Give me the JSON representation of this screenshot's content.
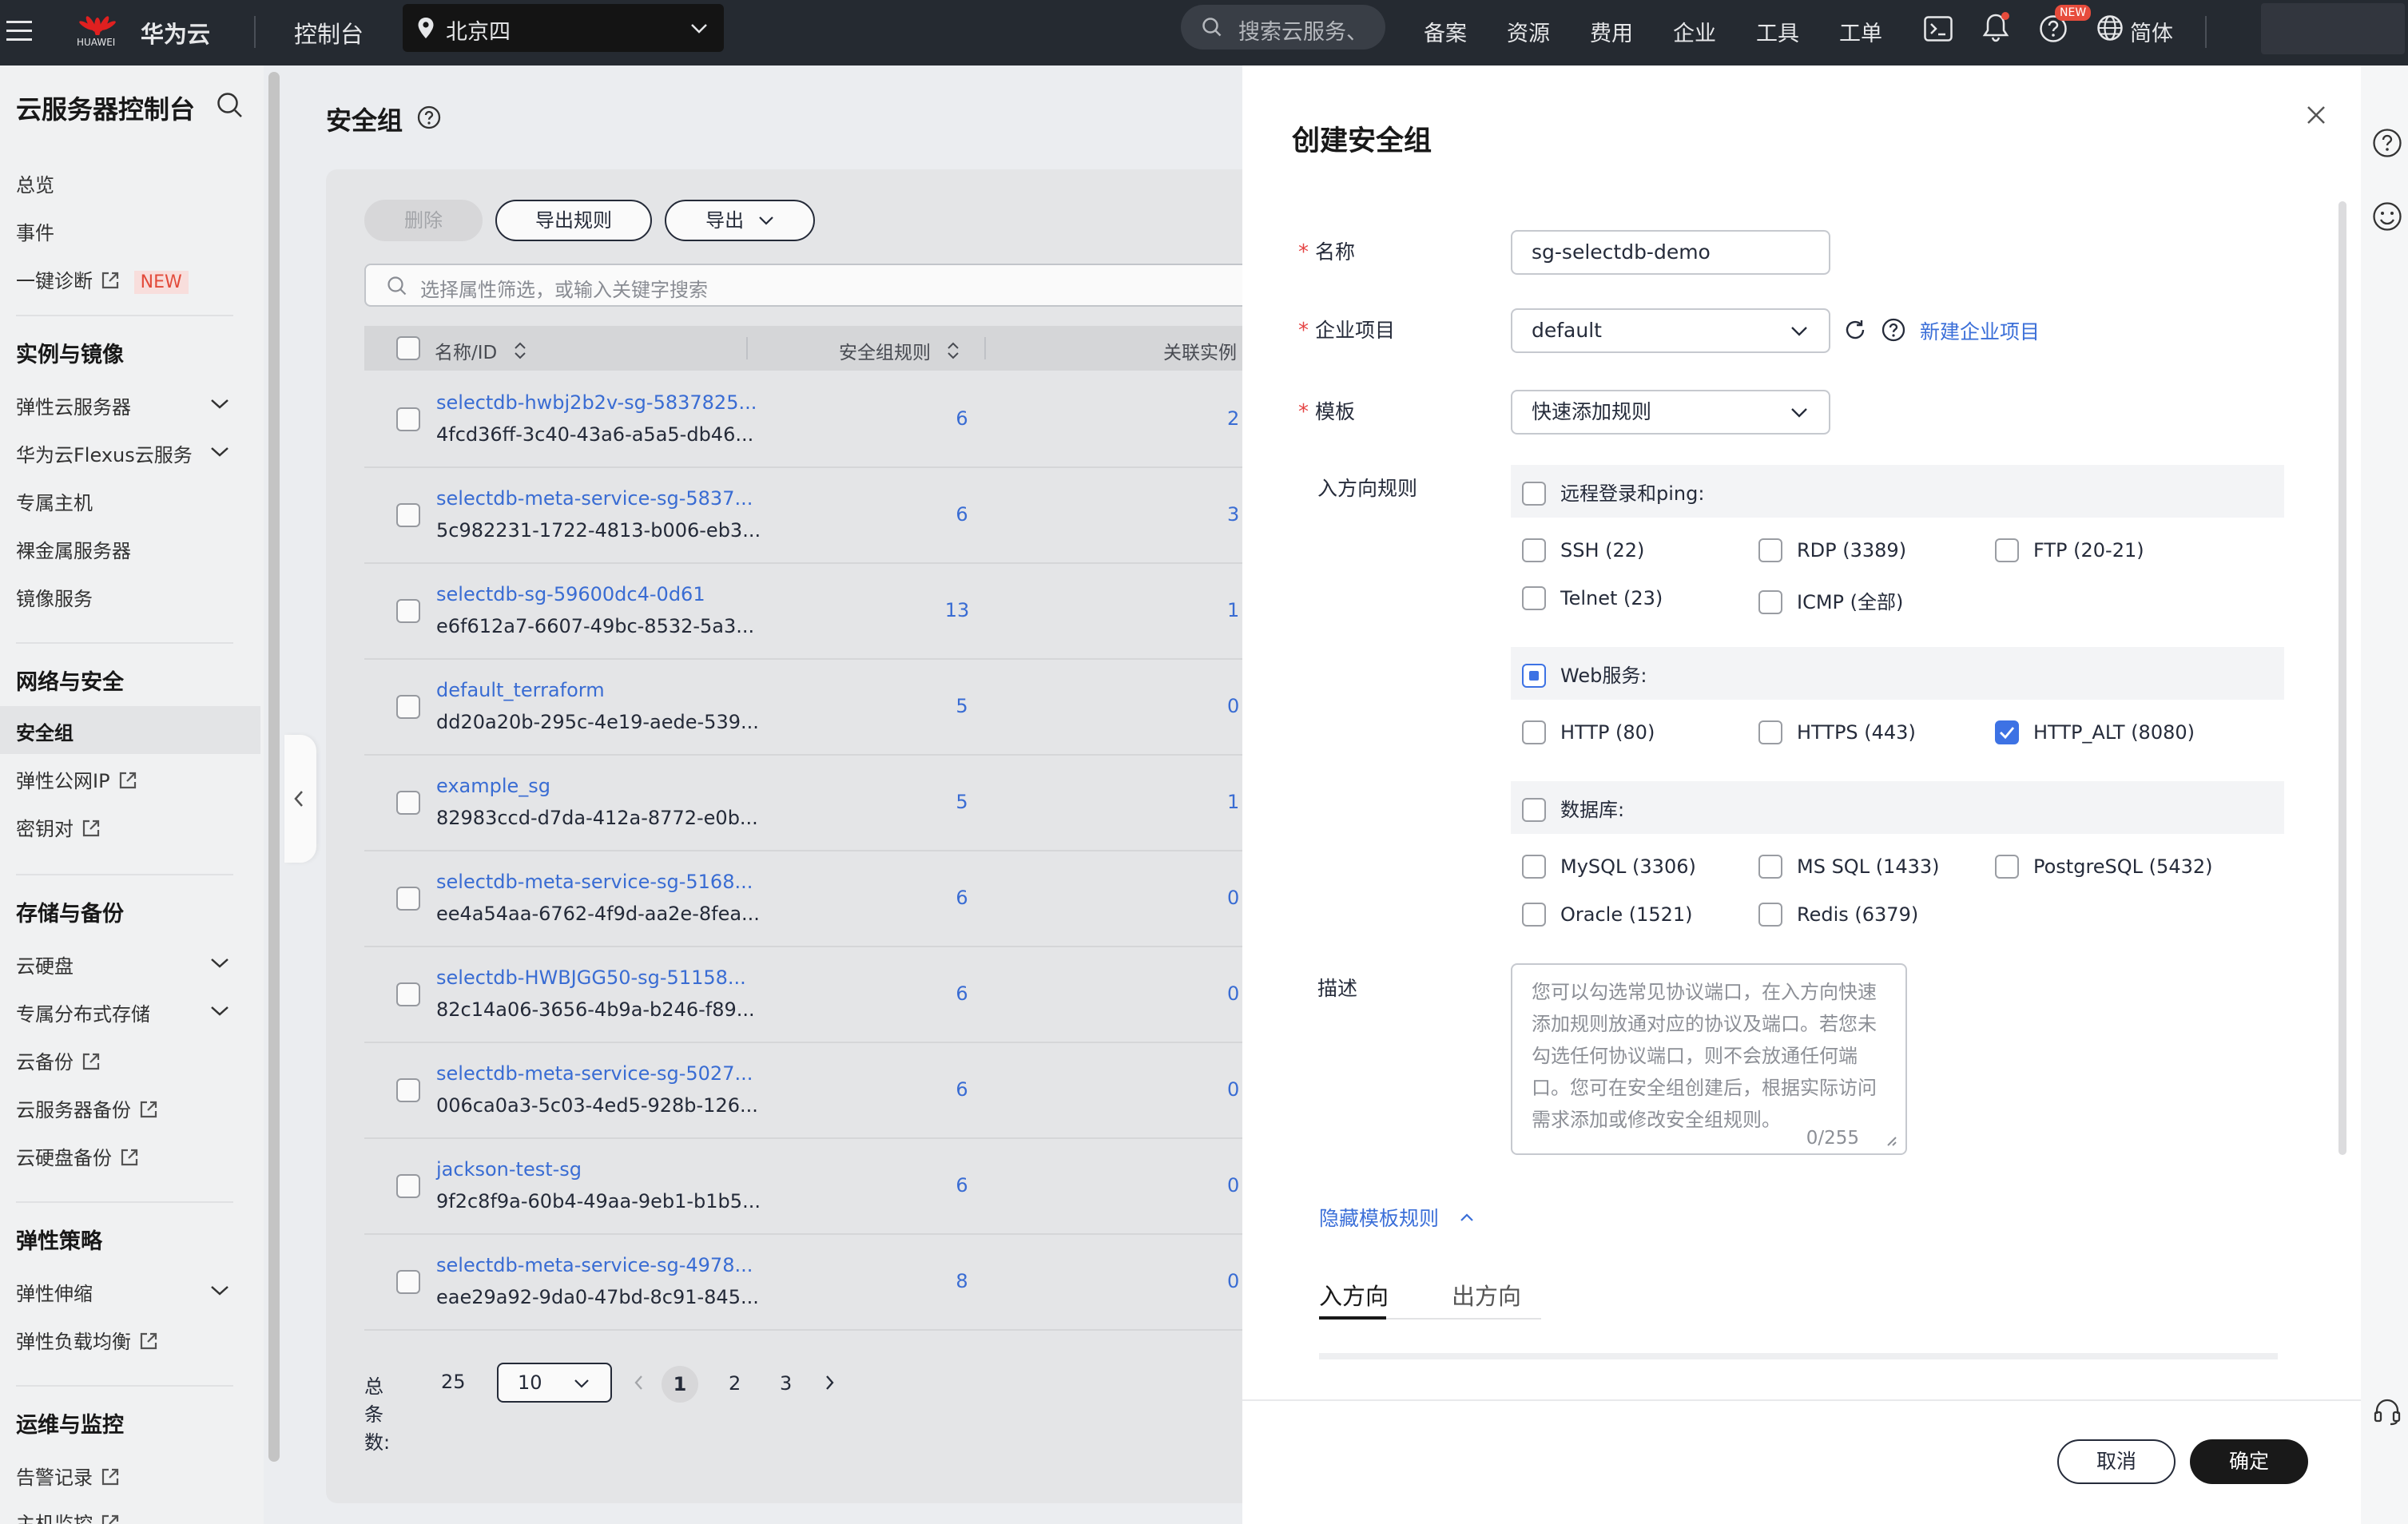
{
  "topbar": {
    "brand_small": "HUAWEI",
    "brand": "华为云",
    "console": "控制台",
    "region": "北京四",
    "search_placeholder": "搜索云服务、",
    "nav": [
      "备案",
      "资源",
      "费用",
      "企业",
      "工具",
      "工单"
    ],
    "new_badge": "NEW",
    "lang": "简体"
  },
  "sidebar": {
    "title": "云服务器控制台",
    "top_items": [
      {
        "label": "总览"
      },
      {
        "label": "事件"
      },
      {
        "label": "一键诊断",
        "badge": "NEW"
      }
    ],
    "groups": [
      {
        "title": "实例与镜像",
        "items": [
          "弹性云服务器",
          "华为云Flexus云服务",
          "专属主机",
          "裸金属服务器",
          "镜像服务"
        ]
      },
      {
        "title": "网络与安全",
        "items": [
          "安全组",
          "弹性公网IP",
          "密钥对"
        ]
      },
      {
        "title": "存储与备份",
        "items": [
          "云硬盘",
          "专属分布式存储",
          "云备份",
          "云服务器备份",
          "云硬盘备份"
        ]
      },
      {
        "title": "弹性策略",
        "items": [
          "弹性伸缩",
          "弹性负载均衡"
        ]
      },
      {
        "title": "运维与监控",
        "items": [
          "告警记录",
          "主机监控"
        ]
      }
    ],
    "active_item": "安全组"
  },
  "main": {
    "title": "安全组",
    "toolbar": {
      "delete": "删除",
      "export_rules": "导出规则",
      "export": "导出"
    },
    "filter_placeholder": "选择属性筛选，或输入关键字搜索",
    "columns": {
      "name": "名称/ID",
      "rules": "安全组规则",
      "related": "关联实例"
    },
    "rows": [
      {
        "name": "selectdb-hwbj2b2v-sg-5837825...",
        "id": "4fcd36ff-3c40-43a6-a5a5-db46...",
        "rules": "6",
        "related": "2"
      },
      {
        "name": "selectdb-meta-service-sg-5837...",
        "id": "5c982231-1722-4813-b006-eb3...",
        "rules": "6",
        "related": "3"
      },
      {
        "name": "selectdb-sg-59600dc4-0d61",
        "id": "e6f612a7-6607-49bc-8532-5a3...",
        "rules": "13",
        "related": "1"
      },
      {
        "name": "default_terraform",
        "id": "dd20a20b-295c-4e19-aede-539...",
        "rules": "5",
        "related": "0"
      },
      {
        "name": "example_sg",
        "id": "82983ccd-d7da-412a-8772-e0b...",
        "rules": "5",
        "related": "1"
      },
      {
        "name": "selectdb-meta-service-sg-5168...",
        "id": "ee4a54aa-6762-4f9d-aa2e-8fea...",
        "rules": "6",
        "related": "0"
      },
      {
        "name": "selectdb-HWBJGG50-sg-51158...",
        "id": "82c14a06-3656-4b9a-b246-f89...",
        "rules": "6",
        "related": "0"
      },
      {
        "name": "selectdb-meta-service-sg-5027...",
        "id": "006ca0a3-5c03-4ed5-928b-126...",
        "rules": "6",
        "related": "0"
      },
      {
        "name": "jackson-test-sg",
        "id": "9f2c8f9a-60b4-49aa-9eb1-b1b5...",
        "rules": "6",
        "related": "0"
      },
      {
        "name": "selectdb-meta-service-sg-4978...",
        "id": "eae29a92-9da0-47bd-8c91-845...",
        "rules": "8",
        "related": "0"
      }
    ],
    "pagination": {
      "total_label": "总条数:",
      "total": "25",
      "page_size": "10",
      "pages": [
        "1",
        "2",
        "3"
      ],
      "current": "1"
    }
  },
  "modal": {
    "title": "创建安全组",
    "name_label": "名称",
    "name_value": "sg-selectdb-demo",
    "project_label": "企业项目",
    "project_value": "default",
    "new_project_link": "新建企业项目",
    "template_label": "模板",
    "template_value": "快速添加规则",
    "inbound_label": "入方向规则",
    "sections": [
      {
        "title": "远程登录和ping:",
        "state": "unchecked",
        "options": [
          {
            "label": "SSH (22)",
            "checked": false
          },
          {
            "label": "RDP (3389)",
            "checked": false
          },
          {
            "label": "FTP (20-21)",
            "checked": false
          },
          {
            "label": "Telnet (23)",
            "checked": false
          },
          {
            "label": "ICMP (全部)",
            "checked": false
          }
        ]
      },
      {
        "title": "Web服务:",
        "state": "partial",
        "options": [
          {
            "label": "HTTP (80)",
            "checked": false
          },
          {
            "label": "HTTPS (443)",
            "checked": false
          },
          {
            "label": "HTTP_ALT (8080)",
            "checked": true
          }
        ]
      },
      {
        "title": "数据库:",
        "state": "unchecked",
        "options": [
          {
            "label": "MySQL (3306)",
            "checked": false
          },
          {
            "label": "MS SQL (1433)",
            "checked": false
          },
          {
            "label": "PostgreSQL (5432)",
            "checked": false
          },
          {
            "label": "Oracle (1521)",
            "checked": false
          },
          {
            "label": "Redis (6379)",
            "checked": false
          }
        ]
      }
    ],
    "desc_label": "描述",
    "desc_placeholder": "您可以勾选常见协议端口，在入方向快速添加规则放通对应的协议及端口。若您未勾选任何协议端口，则不会放通任何端口。您可在安全组创建后，根据实际访问需求添加或修改安全组规则。",
    "desc_count": "0/255",
    "hide_template_link": "隐藏模板规则",
    "tabs": {
      "inbound": "入方向",
      "outbound": "出方向"
    },
    "cancel": "取消",
    "confirm": "确定"
  },
  "colors": {
    "link": "#3b6fd8",
    "topbar": "#252a31",
    "checkbox_checked": "#3d72e4",
    "required": "#e54545",
    "new_badge": "#e74c3c"
  }
}
